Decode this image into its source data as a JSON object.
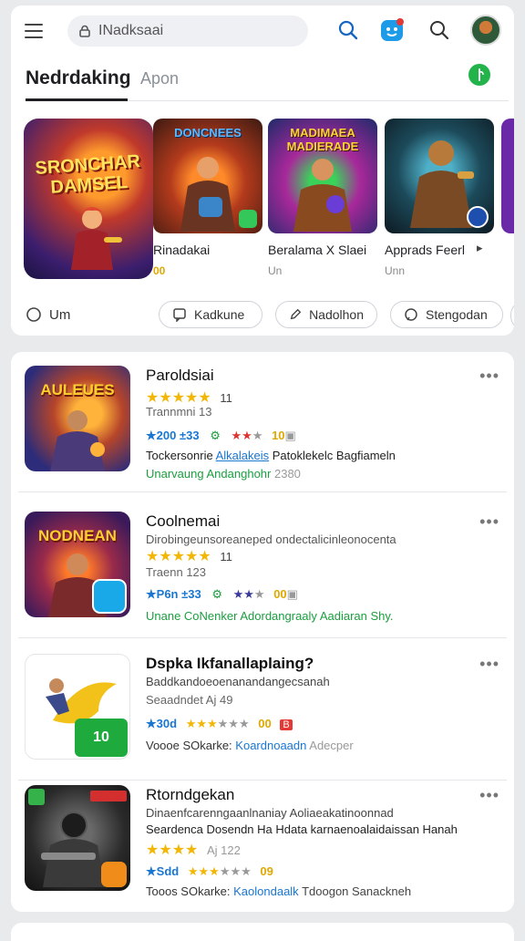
{
  "topbar": {
    "search_text": "INadksaai",
    "tabs": {
      "active": "Nedrdaking",
      "other": "Apon"
    }
  },
  "carousel": {
    "featured_title": "SRONCHAR DAMSEL",
    "items": [
      {
        "thumb_title": "DONCNEES",
        "name": "Rinadakai",
        "sub": "00"
      },
      {
        "thumb_title": "MADIMAEA MADIERADE",
        "name": "Beralama X Slaei",
        "sub": "Un"
      },
      {
        "thumb_title": "",
        "name": "Apprads Feerl",
        "sub": "Unn"
      }
    ]
  },
  "chips": {
    "lead": "Um",
    "items": [
      "Kadkune",
      "Nadolhon",
      "Stengodan"
    ]
  },
  "list": [
    {
      "icon_title": "AULEUES",
      "title": "Paroldsiai",
      "rating_count": "11",
      "line3": "Trannmni 13",
      "stats_a": "★200 ±33",
      "stats_b": "10",
      "desc": "Tockersonrie",
      "desc_link": "Alkalakeis",
      "desc_rest": "Patoklekelc Bagfiameln",
      "tag_green": "Unarvaung",
      "tag_mid": "Andanghohr",
      "tag_gray": "2380"
    },
    {
      "icon_title": "NODNEAN",
      "title": "Coolnemai",
      "line2": "Dirobingeunsoreaneped ondectalicinleonocenta",
      "rating_count": "11",
      "line3": "Traenn 123",
      "stats_a": "★P6n ±33",
      "stats_b": "00",
      "tag_green": "Unane CoNenker",
      "tag_mid": "Adordangraaly",
      "tag_gray": "Aadiaran Shy."
    },
    {
      "title": "Dspka Ikfanallaplaing?",
      "line2": "Baddkandoeoenanandangecsanah",
      "line3": "Seaadndet Aj 49",
      "stats_a": "★30d",
      "stats_b": "00",
      "tag_green": "Voooe SOkarke:",
      "tag_mid": "Koardnoaadn",
      "tag_gray": "Adecper",
      "badge": "10"
    },
    {
      "title": "Rtorndgekan",
      "line2": "Dinaenfcarenngaanlnaniay Aoliaeakatinoonnad",
      "line2b": "Seardenca Dosendn Ha Hdata karnaenoalaidaissan Hanah",
      "line3": "Aj 122",
      "stats_a": "★Sdd",
      "stats_b": "09",
      "tag_green": "Tooos SOkarke:",
      "tag_mid": "Kaolondaalk",
      "tag_gray": "Tdoogon Sanackneh"
    }
  ],
  "colors": {
    "accent": "#1976d2",
    "green": "#1b9e3e",
    "star": "#f2b705"
  }
}
